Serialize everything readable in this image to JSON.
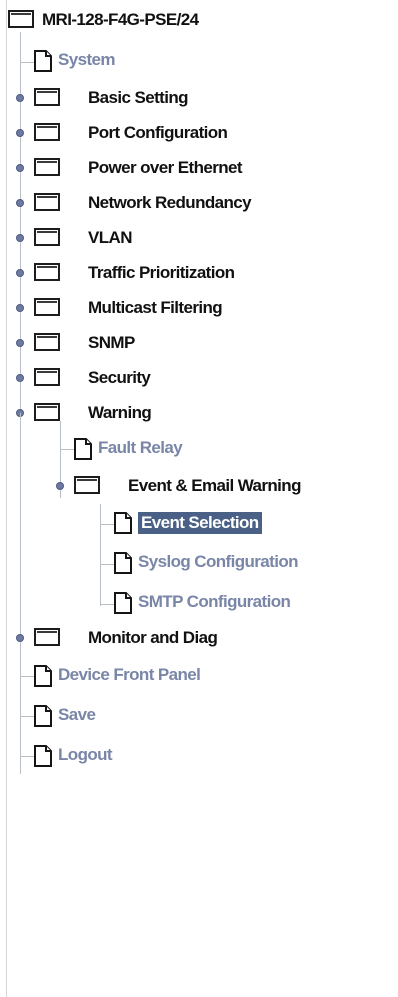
{
  "root": {
    "label": "MRI-128-F4G-PSE/24"
  },
  "menu": {
    "system": "System",
    "basic_setting": "Basic Setting",
    "port_configuration": "Port Configuration",
    "power_over_ethernet": "Power over Ethernet",
    "network_redundancy": "Network Redundancy",
    "vlan": "VLAN",
    "traffic_prioritization": "Traffic Prioritization",
    "multicast_filtering": "Multicast Filtering",
    "snmp": "SNMP",
    "security": "Security",
    "warning": "Warning",
    "fault_relay": "Fault Relay",
    "event_email_warning": "Event & Email Warning",
    "event_selection": "Event Selection",
    "syslog_configuration": "Syslog Configuration",
    "smtp_configuration": "SMTP Configuration",
    "monitor_and_diag": "Monitor and Diag",
    "device_front_panel": "Device Front Panel",
    "save": "Save",
    "logout": "Logout"
  },
  "colors": {
    "link": "#7a86a8",
    "folder_text": "#111111",
    "selected_bg": "#4a6086",
    "selected_text": "#ffffff",
    "tree_line": "#b9bfc7"
  },
  "icons": {
    "folder": "folder-icon",
    "page": "page-icon",
    "toggle": "expand-toggle-icon"
  }
}
